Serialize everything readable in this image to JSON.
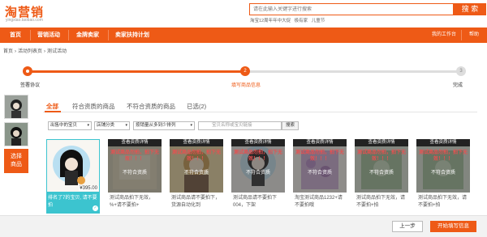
{
  "header": {
    "logo": "淘营销",
    "logo_sub": "yingxiao.taobao.com",
    "search_placeholder": "请在此输入关键字进行搜索",
    "search_button": "搜 索",
    "hot_words": [
      "淘宝12周年年中大促",
      "极有家",
      "儿童节"
    ]
  },
  "nav": {
    "items": [
      "首页",
      "营销活动",
      "金牌卖家",
      "卖家扶持计划"
    ],
    "right_items": [
      "我的工作台",
      "帮助"
    ]
  },
  "breadcrumb": [
    "首页",
    "活动列表页",
    "测试活动"
  ],
  "steps": [
    {
      "label": "签署协议",
      "num": ""
    },
    {
      "label": "填写商品信息",
      "num": "2"
    },
    {
      "label": "完成",
      "num": "3"
    }
  ],
  "side": {
    "add_button": "选择商品"
  },
  "tabs": [
    "全部",
    "符合资质的商品",
    "不符合资质的商品",
    "已选(2)"
  ],
  "filters": {
    "select1": "出售中的宝贝",
    "select2": "店铺分类",
    "select3": "按销量从多到少排列",
    "input_placeholder": "宝贝名称或宝贝链接",
    "search_button": "搜索"
  },
  "overlay": {
    "header": "查看资质详情",
    "warning": "测试商品勿拍，拍下无效！！！",
    "label": "不符合资质"
  },
  "products": [
    {
      "title": "排名了7的宝贝, 请不要拍",
      "price": "¥395.00",
      "selected": true
    },
    {
      "title": "测试商品拍下无效，%+请不要拍+",
      "price": "",
      "selected": false
    },
    {
      "title": "测试商品请不要拍下，货源自动化到",
      "price": "",
      "selected": false
    },
    {
      "title": "测试商品请不要拍下004，下架",
      "price": "",
      "selected": false
    },
    {
      "title": "淘宝测试商品1232+请不要拍哦",
      "price": "",
      "selected": false
    },
    {
      "title": "测试商品拍下无效，请不要拍+拍",
      "price": "",
      "selected": false
    },
    {
      "title": "测试商品拍下无效，请不要拍+拍",
      "price": "",
      "selected": false
    }
  ],
  "footer": {
    "prev_button": "上一步",
    "next_button": "开始填写信息"
  },
  "colors": {
    "accent": "#ee5a16",
    "selected": "#3cc4cf"
  }
}
